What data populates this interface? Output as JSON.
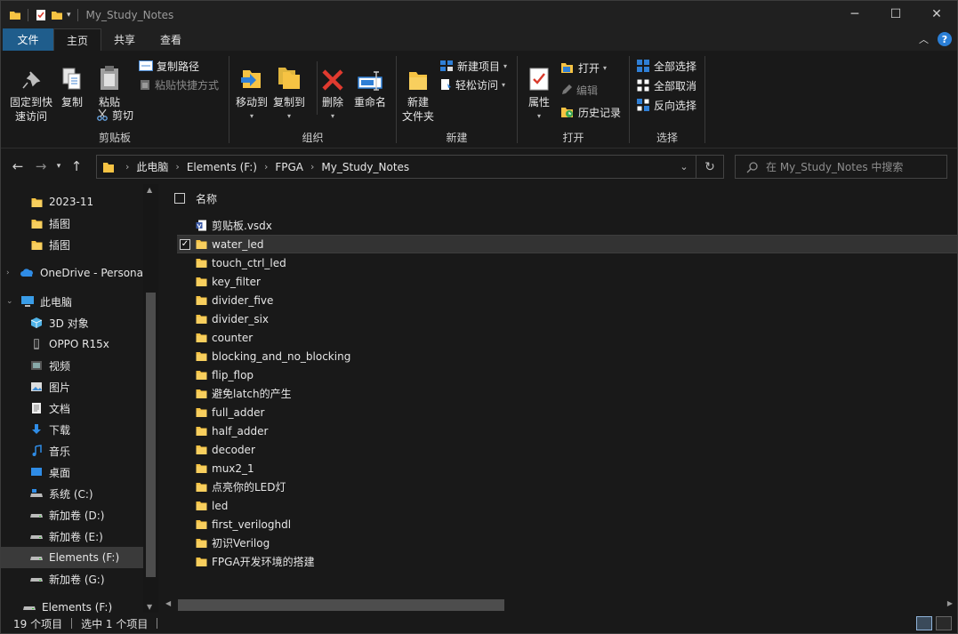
{
  "window": {
    "title": "My_Study_Notes",
    "controls": {
      "minimize": "─",
      "maximize": "☐",
      "close": "✕"
    }
  },
  "ribbon_tabs": [
    "文件",
    "主页",
    "共享",
    "查看"
  ],
  "help_label": "?",
  "ribbon": {
    "clipboard": {
      "label": "剪贴板",
      "pin": "固定到快\n速访问",
      "copy": "复制",
      "paste": "粘贴",
      "copy_path": "复制路径",
      "paste_shortcut": "粘贴快捷方式",
      "cut": "剪切"
    },
    "organize": {
      "label": "组织",
      "move_to": "移动到",
      "copy_to": "复制到",
      "delete": "删除",
      "rename": "重命名"
    },
    "new": {
      "label": "新建",
      "new_folder": "新建\n文件夹",
      "new_item": "新建项目",
      "easy_access": "轻松访问"
    },
    "open": {
      "label": "打开",
      "properties": "属性",
      "open": "打开",
      "edit": "编辑",
      "history": "历史记录"
    },
    "select": {
      "label": "选择",
      "select_all": "全部选择",
      "select_none": "全部取消",
      "invert": "反向选择"
    }
  },
  "address": {
    "crumbs": [
      "此电脑",
      "Elements (F:)",
      "FPGA",
      "My_Study_Notes"
    ]
  },
  "search": {
    "placeholder": "在 My_Study_Notes 中搜索"
  },
  "nav_pane": [
    {
      "label": "2023-11",
      "icon": "folder-icon"
    },
    {
      "label": "插图",
      "icon": "folder-icon"
    },
    {
      "label": "插图",
      "icon": "folder-icon"
    },
    {
      "label": "OneDrive - Persona",
      "icon": "onedrive-icon"
    },
    {
      "label": "此电脑",
      "icon": "pc-icon"
    },
    {
      "label": "3D 对象",
      "icon": "3d-objects-icon"
    },
    {
      "label": "OPPO R15x",
      "icon": "phone-icon"
    },
    {
      "label": "视频",
      "icon": "video-icon"
    },
    {
      "label": "图片",
      "icon": "pictures-icon"
    },
    {
      "label": "文档",
      "icon": "documents-icon"
    },
    {
      "label": "下载",
      "icon": "download-icon"
    },
    {
      "label": "音乐",
      "icon": "music-icon"
    },
    {
      "label": "桌面",
      "icon": "desktop-icon"
    },
    {
      "label": "系统 (C:)",
      "icon": "system-drive-icon"
    },
    {
      "label": "新加卷 (D:)",
      "icon": "drive-icon"
    },
    {
      "label": "新加卷 (E:)",
      "icon": "drive-icon"
    },
    {
      "label": "Elements (F:)",
      "icon": "drive-icon"
    },
    {
      "label": "新加卷 (G:)",
      "icon": "drive-icon"
    },
    {
      "label": "Elements (F:)",
      "icon": "drive-icon"
    }
  ],
  "list_header": {
    "name": "名称"
  },
  "files": [
    {
      "name": "剪贴板.vsdx",
      "type": "visio",
      "selected": false
    },
    {
      "name": "water_led",
      "type": "folder",
      "selected": true
    },
    {
      "name": "touch_ctrl_led",
      "type": "folder",
      "selected": false
    },
    {
      "name": "key_filter",
      "type": "folder",
      "selected": false
    },
    {
      "name": "divider_five",
      "type": "folder",
      "selected": false
    },
    {
      "name": "divider_six",
      "type": "folder",
      "selected": false
    },
    {
      "name": "counter",
      "type": "folder",
      "selected": false
    },
    {
      "name": "blocking_and_no_blocking",
      "type": "folder",
      "selected": false
    },
    {
      "name": "flip_flop",
      "type": "folder",
      "selected": false
    },
    {
      "name": "避免latch的产生",
      "type": "folder",
      "selected": false
    },
    {
      "name": "full_adder",
      "type": "folder",
      "selected": false
    },
    {
      "name": "half_adder",
      "type": "folder",
      "selected": false
    },
    {
      "name": "decoder",
      "type": "folder",
      "selected": false
    },
    {
      "name": "mux2_1",
      "type": "folder",
      "selected": false
    },
    {
      "name": "点亮你的LED灯",
      "type": "folder",
      "selected": false
    },
    {
      "name": "led",
      "type": "folder",
      "selected": false
    },
    {
      "name": "first_veriloghdl",
      "type": "folder",
      "selected": false
    },
    {
      "name": "初识Verilog",
      "type": "folder",
      "selected": false
    },
    {
      "name": "FPGA开发环境的搭建",
      "type": "folder",
      "selected": false
    }
  ],
  "status": {
    "count": "19 个项目",
    "selected": "选中 1 个项目"
  },
  "colors": {
    "accent": "#1f5d8c",
    "folder": "#f6c343",
    "background": "#191919"
  }
}
